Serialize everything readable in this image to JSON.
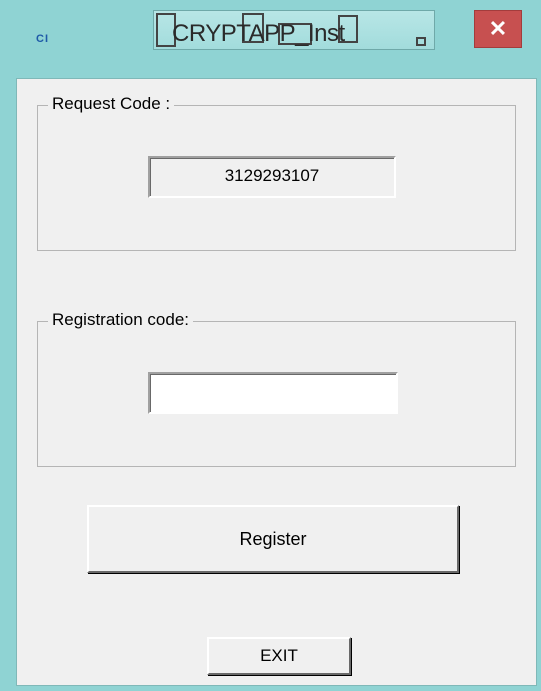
{
  "window": {
    "title": "CRYPTAPP_Inst",
    "icon_text": "CI",
    "close_glyph": "✕",
    "close_color": "#c75050",
    "frame_color": "#8fd3d3"
  },
  "request_group": {
    "label": "Request Code :",
    "code_value": "3129293107"
  },
  "registration_group": {
    "label": "Registration code:",
    "input_value": "",
    "input_placeholder": ""
  },
  "buttons": {
    "register_label": "Register",
    "exit_label": "EXIT"
  }
}
